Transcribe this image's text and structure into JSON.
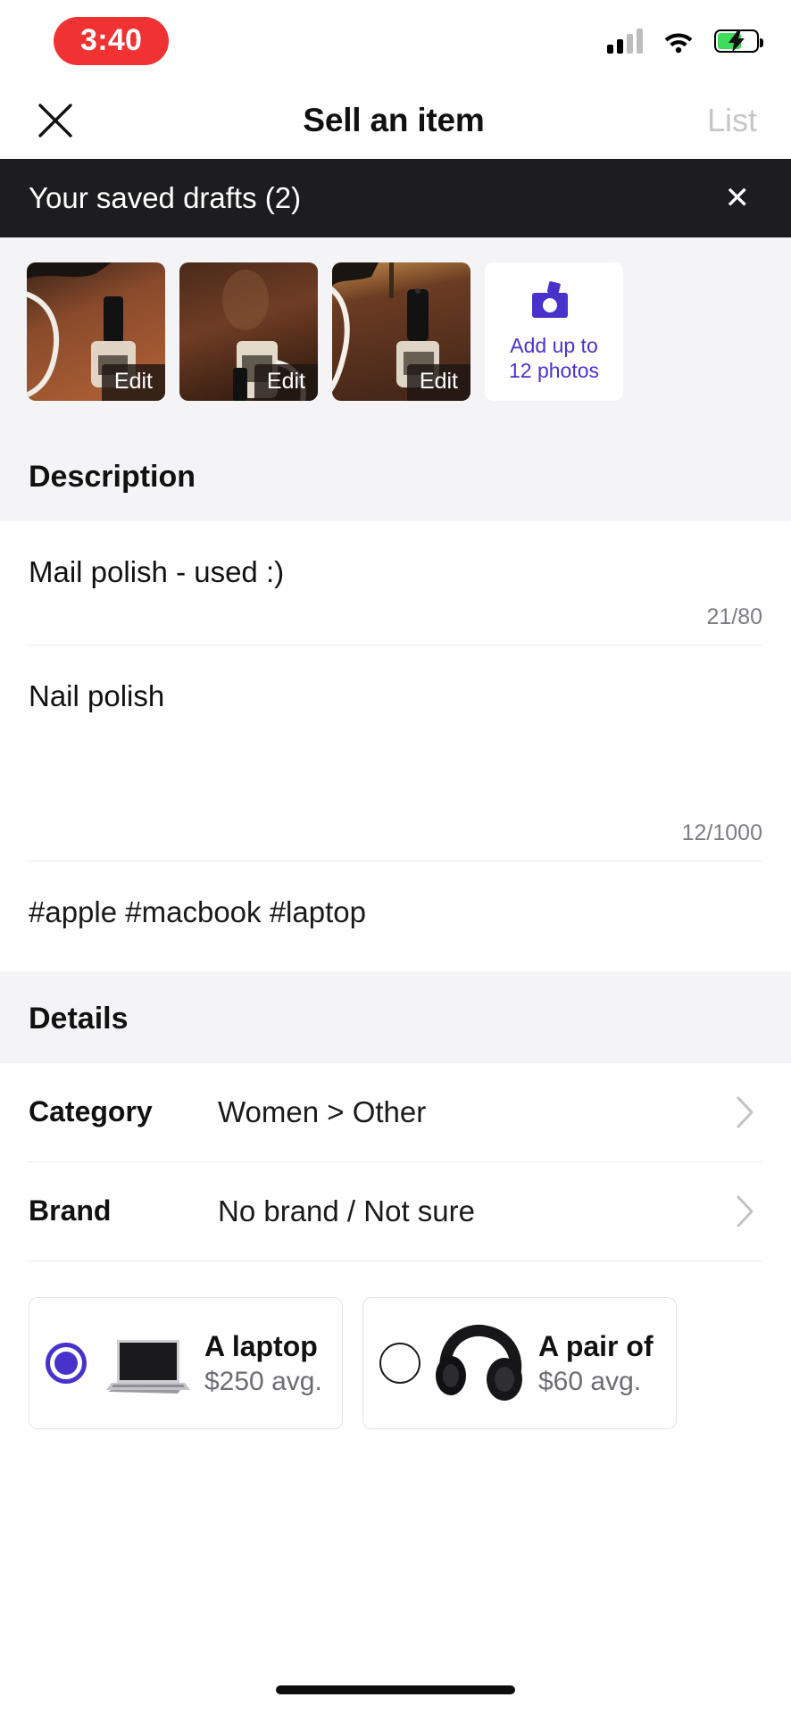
{
  "status_bar": {
    "recording_time": "3:40",
    "cellular_icon": "cellular-bars-icon",
    "wifi_icon": "wifi-icon",
    "battery_icon": "battery-charging-icon"
  },
  "nav": {
    "close_icon": "close-icon",
    "title": "Sell an item",
    "action_label": "List"
  },
  "drafts_banner": {
    "label": "Your saved drafts (2)",
    "close_icon": "close-icon"
  },
  "photos": {
    "thumbnails": [
      {
        "alt": "nail-polish-photo-1",
        "edit_label": "Edit"
      },
      {
        "alt": "nail-polish-photo-2",
        "edit_label": "Edit"
      },
      {
        "alt": "nail-polish-photo-3",
        "edit_label": "Edit"
      }
    ],
    "add_tile": {
      "icon": "camera-icon",
      "line1": "Add up to",
      "line2": "12 photos",
      "color": "#4733cc"
    }
  },
  "description_section": {
    "heading": "Description",
    "title_field": {
      "value": "Mail polish - used :)",
      "counter": "21/80"
    },
    "body_field": {
      "value": "Nail polish",
      "counter": "12/1000"
    },
    "tags_field": {
      "placeholder": "#apple #macbook #laptop"
    }
  },
  "details_section": {
    "heading": "Details",
    "rows": [
      {
        "label": "Category",
        "value": "Women > Other",
        "chevron": "chevron-right-icon"
      },
      {
        "label": "Brand",
        "value": "No brand / Not sure",
        "chevron": "chevron-right-icon"
      }
    ]
  },
  "suggestion_cards": [
    {
      "title": "A laptop",
      "price": "$250 avg.",
      "art": "laptop-image",
      "selected": true
    },
    {
      "title": "A pair of",
      "price": "$60 avg.",
      "art": "headphones-image",
      "selected": false
    }
  ],
  "home_indicator": "home-indicator"
}
